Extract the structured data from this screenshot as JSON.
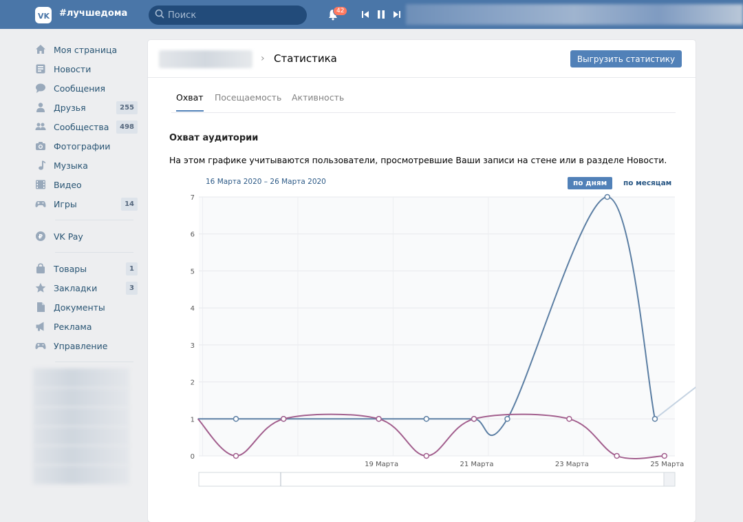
{
  "topbar": {
    "brand": "#лучшедома",
    "search_placeholder": "Поиск",
    "notifications_count": "42",
    "colors": {
      "bar": "#4a76a8",
      "search": "#224b7a",
      "badge": "#ff7960"
    }
  },
  "sidebar": {
    "group1": [
      {
        "label": "Моя страница",
        "icon": "home-icon"
      },
      {
        "label": "Новости",
        "icon": "news-icon"
      },
      {
        "label": "Сообщения",
        "icon": "messages-icon"
      },
      {
        "label": "Друзья",
        "icon": "friends-icon",
        "count": "255"
      },
      {
        "label": "Сообщества",
        "icon": "communities-icon",
        "count": "498"
      },
      {
        "label": "Фотографии",
        "icon": "camera-icon"
      },
      {
        "label": "Музыка",
        "icon": "music-icon"
      },
      {
        "label": "Видео",
        "icon": "video-icon"
      },
      {
        "label": "Игры",
        "icon": "games-icon",
        "count": "14"
      }
    ],
    "group2": [
      {
        "label": "VK Pay",
        "icon": "vkpay-icon"
      }
    ],
    "group3": [
      {
        "label": "Товары",
        "icon": "bag-icon",
        "count": "1"
      },
      {
        "label": "Закладки",
        "icon": "star-icon",
        "count": "3"
      },
      {
        "label": "Документы",
        "icon": "document-icon"
      },
      {
        "label": "Реклама",
        "icon": "megaphone-icon"
      },
      {
        "label": "Управление",
        "icon": "gamepad-icon"
      }
    ]
  },
  "header": {
    "title": "Статистика",
    "export_label": "Выгрузить статистику"
  },
  "tabs": [
    {
      "label": "Охват",
      "active": true
    },
    {
      "label": "Посещаемость",
      "active": false
    },
    {
      "label": "Активность",
      "active": false
    }
  ],
  "section": {
    "title": "Охват аудитории",
    "description": "На этом графике учитываются пользователи, просмотревшие Ваши записи на стене или в разделе Новости."
  },
  "chart_controls": {
    "range": "16 Марта 2020 – 26 Марта 2020",
    "by_days": "по дням",
    "by_months": "по месяцам"
  },
  "chart_data": {
    "type": "line",
    "x": [
      "16 Марта",
      "17 Марта",
      "18 Марта",
      "19 Марта",
      "20 Марта",
      "21 Марта",
      "22 Марта",
      "23 Марта",
      "24 Марта",
      "25 Марта",
      "26 Марта"
    ],
    "x_tick_labels": [
      "19 Марта",
      "21 Марта",
      "23 Марта",
      "25 Марта"
    ],
    "ylim": [
      0,
      7
    ],
    "yticks": [
      0,
      1,
      2,
      3,
      4,
      5,
      6,
      7
    ],
    "grid": true,
    "series": [
      {
        "color": "#5b7ea3",
        "values": [
          1,
          1,
          1,
          1,
          1,
          1,
          1,
          7,
          1,
          2
        ]
      },
      {
        "color": "#a25e8d",
        "values": [
          1,
          0,
          1,
          1,
          0,
          1,
          1,
          0,
          0
        ]
      }
    ]
  }
}
